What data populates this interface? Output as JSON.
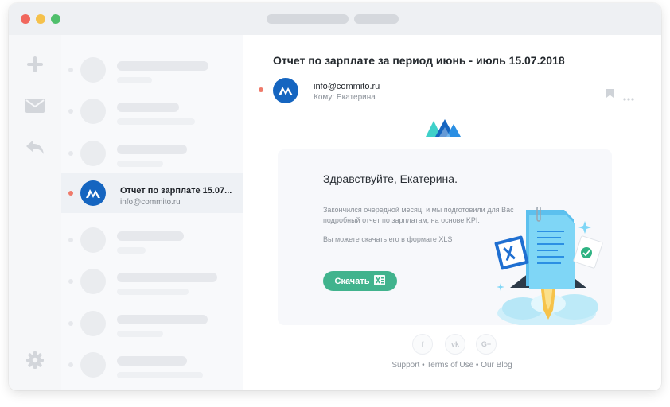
{
  "colors": {
    "accent_green": "#41b38d",
    "brand_blue": "#1565c0",
    "unread_dot": "#ef7a6a"
  },
  "toolbar_icons": [
    "plus-icon",
    "envelope-icon",
    "reply-icon",
    "gear-icon"
  ],
  "message_list": {
    "active_item": {
      "subject": "Отчет по зарплате 15.07...",
      "sender": "info@commito.ru"
    },
    "placeholder_rows": 7
  },
  "email": {
    "subject": "Отчет по зарплате за период июнь - июль 15.07.2018",
    "from": "info@commito.ru",
    "to": "Кому: Екатерина",
    "greeting": "Здравствуйте, Екатерина.",
    "body_line1": "Закончился очередной  месяц, и мы подготовили для Вас подробный отчет по зарплатам, на основе KPI.",
    "body_line2": "Вы можете скачать его в формате XLS",
    "download_label": "Скачать"
  },
  "social": {
    "facebook": "f",
    "vk": "vk",
    "google": "G+"
  },
  "footer": {
    "support": "Support",
    "sep1": " • ",
    "terms": "Terms of Use",
    "sep2": " • ",
    "blog": "Our Blog"
  }
}
